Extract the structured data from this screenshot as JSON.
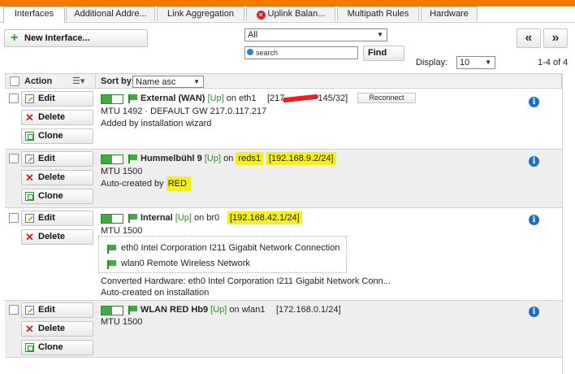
{
  "tabs": [
    {
      "label": "Interfaces",
      "active": true
    },
    {
      "label": "Additional Addre...",
      "active": false
    },
    {
      "label": "Link Aggregation",
      "active": false
    },
    {
      "label": "Uplink Balan...",
      "active": false,
      "error": true
    },
    {
      "label": "Multipath Rules",
      "active": false
    },
    {
      "label": "Hardware",
      "active": false
    }
  ],
  "toolbar": {
    "new_interface_label": "New Interface...",
    "filter_value": "All",
    "search_placeholder": "search",
    "find_label": "Find",
    "prev_label": "«",
    "next_label": "»",
    "display_label": "Display:",
    "display_value": "10",
    "count_text": "1-4 of 4"
  },
  "table_header": {
    "action_label": "Action",
    "sort_by_label": "Sort by:",
    "sort_value": "Name asc"
  },
  "actions": {
    "edit": "Edit",
    "delete": "Delete",
    "clone": "Clone"
  },
  "interfaces": [
    {
      "name": "External (WAN)",
      "status": "[Up]",
      "on_text": "on eth1",
      "address_prefix": "[217.",
      "address_suffix": "145/32]",
      "reconnect_label": "Reconnect",
      "line2": "MTU 1492 · DEFAULT GW 217.0.117.217",
      "line3": "Added by installation wizard"
    },
    {
      "name": "Hummelbühl 9",
      "status": "[Up]",
      "on_text": "on",
      "device": "reds1",
      "address": "[192.168.9.2/24]",
      "line2": "MTU 1500",
      "line3_prefix": "Auto-created by",
      "line3_hl": "RED"
    },
    {
      "name": "Internal",
      "status": "[Up]",
      "on_text": "on br0",
      "address": "[192.168.42.1/24]",
      "line2": "MTU 1500",
      "hardware": [
        "eth0 Intel Corporation I211 Gigabit Network Connection",
        "wlan0 Remote Wireless Network"
      ],
      "line_converted": "Converted Hardware: eth0 Intel Corporation I211 Gigabit Network Conn...",
      "line_auto": "Auto-created on installation"
    },
    {
      "name": "WLAN RED Hb9",
      "status": "[Up]",
      "on_text": "on wlan1",
      "address": "[172.168.0.1/24]",
      "line2": "MTU 1500"
    }
  ],
  "colors": {
    "accent": "#f07d00",
    "up": "#2f8a2f",
    "highlight": "#f6ef1f",
    "info": "#1a6fc9"
  }
}
